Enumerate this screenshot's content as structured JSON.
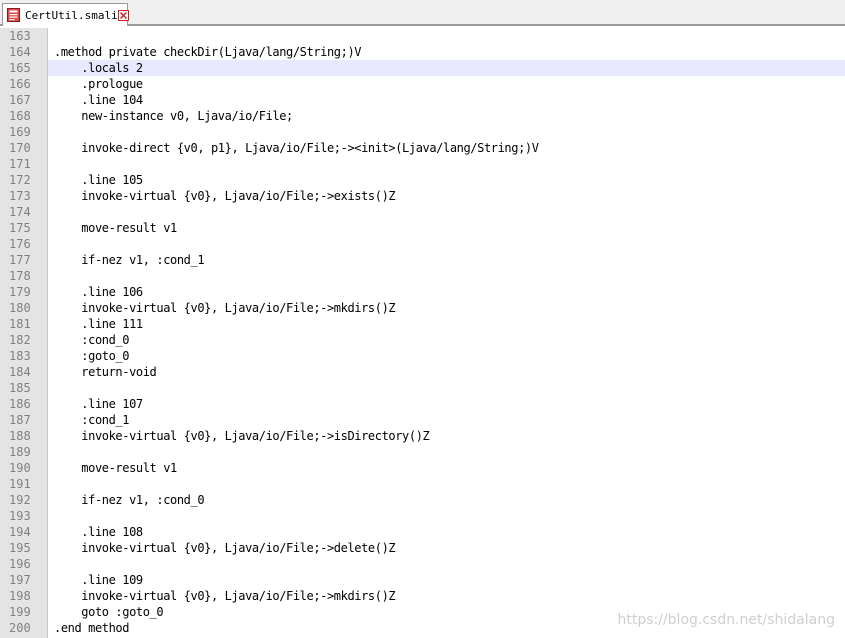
{
  "tab": {
    "label": "CertUtil.smali",
    "icon": "file-icon",
    "close_icon": "close-icon",
    "colors": {
      "icon": "#cc2222",
      "close": "#cc2222"
    }
  },
  "editor": {
    "current_line": 165,
    "lines": [
      {
        "num": "163",
        "text": ""
      },
      {
        "num": "164",
        "text": ".method private checkDir(Ljava/lang/String;)V"
      },
      {
        "num": "165",
        "text": "    .locals 2"
      },
      {
        "num": "166",
        "text": "    .prologue"
      },
      {
        "num": "167",
        "text": "    .line 104"
      },
      {
        "num": "168",
        "text": "    new-instance v0, Ljava/io/File;"
      },
      {
        "num": "169",
        "text": ""
      },
      {
        "num": "170",
        "text": "    invoke-direct {v0, p1}, Ljava/io/File;-><init>(Ljava/lang/String;)V"
      },
      {
        "num": "171",
        "text": ""
      },
      {
        "num": "172",
        "text": "    .line 105"
      },
      {
        "num": "173",
        "text": "    invoke-virtual {v0}, Ljava/io/File;->exists()Z"
      },
      {
        "num": "174",
        "text": ""
      },
      {
        "num": "175",
        "text": "    move-result v1"
      },
      {
        "num": "176",
        "text": ""
      },
      {
        "num": "177",
        "text": "    if-nez v1, :cond_1"
      },
      {
        "num": "178",
        "text": ""
      },
      {
        "num": "179",
        "text": "    .line 106"
      },
      {
        "num": "180",
        "text": "    invoke-virtual {v0}, Ljava/io/File;->mkdirs()Z"
      },
      {
        "num": "181",
        "text": "    .line 111"
      },
      {
        "num": "182",
        "text": "    :cond_0"
      },
      {
        "num": "183",
        "text": "    :goto_0"
      },
      {
        "num": "184",
        "text": "    return-void"
      },
      {
        "num": "185",
        "text": ""
      },
      {
        "num": "186",
        "text": "    .line 107"
      },
      {
        "num": "187",
        "text": "    :cond_1"
      },
      {
        "num": "188",
        "text": "    invoke-virtual {v0}, Ljava/io/File;->isDirectory()Z"
      },
      {
        "num": "189",
        "text": ""
      },
      {
        "num": "190",
        "text": "    move-result v1"
      },
      {
        "num": "191",
        "text": ""
      },
      {
        "num": "192",
        "text": "    if-nez v1, :cond_0"
      },
      {
        "num": "193",
        "text": ""
      },
      {
        "num": "194",
        "text": "    .line 108"
      },
      {
        "num": "195",
        "text": "    invoke-virtual {v0}, Ljava/io/File;->delete()Z"
      },
      {
        "num": "196",
        "text": ""
      },
      {
        "num": "197",
        "text": "    .line 109"
      },
      {
        "num": "198",
        "text": "    invoke-virtual {v0}, Ljava/io/File;->mkdirs()Z"
      },
      {
        "num": "199",
        "text": "    goto :goto_0"
      },
      {
        "num": "200",
        "text": ".end method"
      }
    ]
  },
  "watermark": "https://blog.csdn.net/shidalang"
}
